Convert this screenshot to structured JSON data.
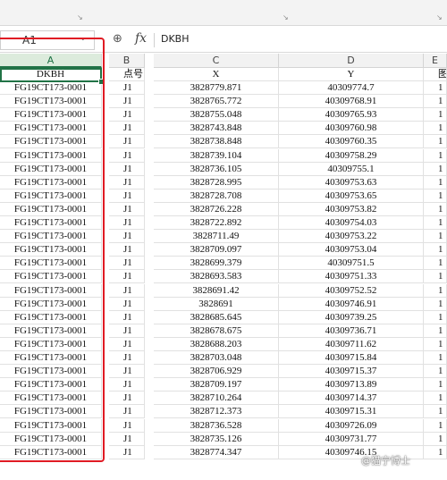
{
  "namebox": {
    "value": "A1"
  },
  "formula_bar": {
    "zoom_icon": "zoom-icon",
    "fx_label": "fx",
    "content": "DKBH"
  },
  "columns": [
    {
      "letter": "A",
      "selected": true
    },
    {
      "letter": "B",
      "selected": false
    },
    {
      "letter": "C",
      "selected": false
    },
    {
      "letter": "D",
      "selected": false
    },
    {
      "letter": "E",
      "selected": false
    }
  ],
  "header": {
    "a": "DKBH",
    "b": "点号",
    "c": "X",
    "d": "Y",
    "e": "图"
  },
  "rows": [
    {
      "a": "FG19CT173-0001",
      "b": "J1",
      "c": "3828779.871",
      "d": "40309774.7",
      "e": "1"
    },
    {
      "a": "FG19CT173-0001",
      "b": "J1",
      "c": "3828765.772",
      "d": "40309768.91",
      "e": "1"
    },
    {
      "a": "FG19CT173-0001",
      "b": "J1",
      "c": "3828755.048",
      "d": "40309765.93",
      "e": "1"
    },
    {
      "a": "FG19CT173-0001",
      "b": "J1",
      "c": "3828743.848",
      "d": "40309760.98",
      "e": "1"
    },
    {
      "a": "FG19CT173-0001",
      "b": "J1",
      "c": "3828738.848",
      "d": "40309760.35",
      "e": "1"
    },
    {
      "a": "FG19CT173-0001",
      "b": "J1",
      "c": "3828739.104",
      "d": "40309758.29",
      "e": "1"
    },
    {
      "a": "FG19CT173-0001",
      "b": "J1",
      "c": "3828736.105",
      "d": "40309755.1",
      "e": "1"
    },
    {
      "a": "FG19CT173-0001",
      "b": "J1",
      "c": "3828728.995",
      "d": "40309753.63",
      "e": "1"
    },
    {
      "a": "FG19CT173-0001",
      "b": "J1",
      "c": "3828728.708",
      "d": "40309753.65",
      "e": "1"
    },
    {
      "a": "FG19CT173-0001",
      "b": "J1",
      "c": "3828726.228",
      "d": "40309753.82",
      "e": "1"
    },
    {
      "a": "FG19CT173-0001",
      "b": "J1",
      "c": "3828722.892",
      "d": "40309754.03",
      "e": "1"
    },
    {
      "a": "FG19CT173-0001",
      "b": "J1",
      "c": "3828711.49",
      "d": "40309753.22",
      "e": "1"
    },
    {
      "a": "FG19CT173-0001",
      "b": "J1",
      "c": "3828709.097",
      "d": "40309753.04",
      "e": "1"
    },
    {
      "a": "FG19CT173-0001",
      "b": "J1",
      "c": "3828699.379",
      "d": "40309751.5",
      "e": "1"
    },
    {
      "a": "FG19CT173-0001",
      "b": "J1",
      "c": "3828693.583",
      "d": "40309751.33",
      "e": "1"
    },
    {
      "a": "FG19CT173-0001",
      "b": "J1",
      "c": "3828691.42",
      "d": "40309752.52",
      "e": "1"
    },
    {
      "a": "FG19CT173-0001",
      "b": "J1",
      "c": "3828691",
      "d": "40309746.91",
      "e": "1"
    },
    {
      "a": "FG19CT173-0001",
      "b": "J1",
      "c": "3828685.645",
      "d": "40309739.25",
      "e": "1"
    },
    {
      "a": "FG19CT173-0001",
      "b": "J1",
      "c": "3828678.675",
      "d": "40309736.71",
      "e": "1"
    },
    {
      "a": "FG19CT173-0001",
      "b": "J1",
      "c": "3828688.203",
      "d": "40309711.62",
      "e": "1"
    },
    {
      "a": "FG19CT173-0001",
      "b": "J1",
      "c": "3828703.048",
      "d": "40309715.84",
      "e": "1"
    },
    {
      "a": "FG19CT173-0001",
      "b": "J1",
      "c": "3828706.929",
      "d": "40309715.37",
      "e": "1"
    },
    {
      "a": "FG19CT173-0001",
      "b": "J1",
      "c": "3828709.197",
      "d": "40309713.89",
      "e": "1"
    },
    {
      "a": "FG19CT173-0001",
      "b": "J1",
      "c": "3828710.264",
      "d": "40309714.37",
      "e": "1"
    },
    {
      "a": "FG19CT173-0001",
      "b": "J1",
      "c": "3828712.373",
      "d": "40309715.31",
      "e": "1"
    },
    {
      "a": "FG19CT173-0001",
      "b": "J1",
      "c": "3828736.528",
      "d": "40309726.09",
      "e": "1"
    },
    {
      "a": "FG19CT173-0001",
      "b": "J1",
      "c": "3828735.126",
      "d": "40309731.77",
      "e": "1"
    },
    {
      "a": "FG19CT173-0001",
      "b": "J1",
      "c": "3828774.347",
      "d": "40309746.15",
      "e": "1"
    }
  ],
  "watermark": "@猫宁博士",
  "colors": {
    "accent": "#217346",
    "highlight": "#e01b24"
  }
}
